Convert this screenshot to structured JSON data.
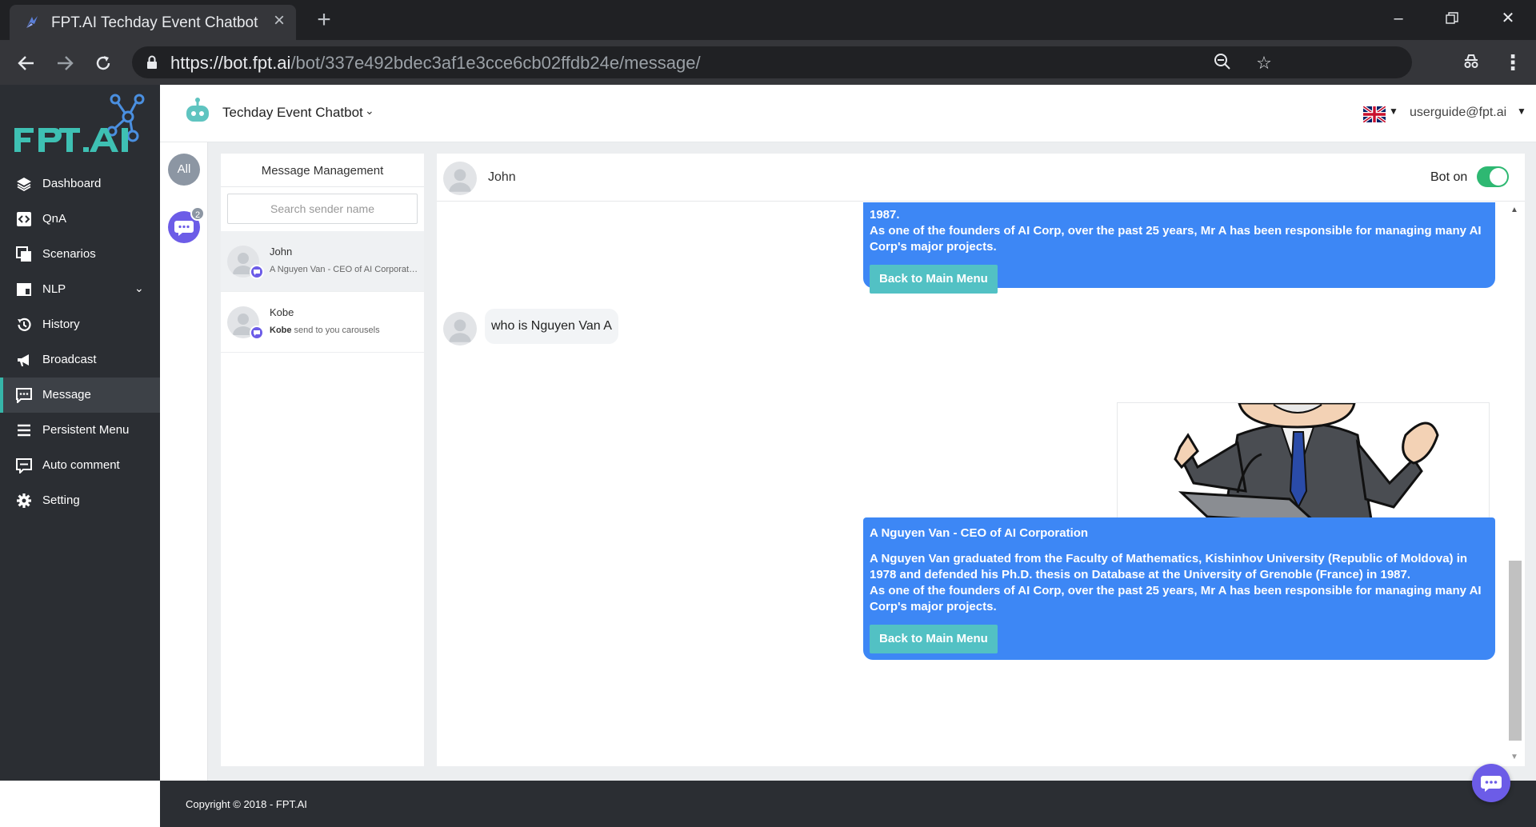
{
  "browser": {
    "tab_title": "FPT.AI Techday Event Chatbot",
    "url_host": "https://bot.fpt.ai",
    "url_path": "/bot/337e492bdec3af1e3cce6cb02ffdb24e/message/"
  },
  "sidebar": {
    "items": [
      {
        "label": "Dashboard",
        "icon": "layers-icon"
      },
      {
        "label": "QnA",
        "icon": "code-icon"
      },
      {
        "label": "Scenarios",
        "icon": "scenarios-icon"
      },
      {
        "label": "NLP",
        "icon": "nlp-icon"
      },
      {
        "label": "History",
        "icon": "history-icon"
      },
      {
        "label": "Broadcast",
        "icon": "megaphone-icon"
      },
      {
        "label": "Message",
        "icon": "message-icon"
      },
      {
        "label": "Persistent Menu",
        "icon": "hamburger-icon"
      },
      {
        "label": "Auto comment",
        "icon": "comment-icon"
      },
      {
        "label": "Setting",
        "icon": "gear-icon"
      }
    ],
    "active_item": "Message"
  },
  "header": {
    "bot_name": "Techday Event Chatbot",
    "user_email": "userguide@fpt.ai"
  },
  "filters": {
    "all_label": "All",
    "message_badge": "2"
  },
  "message_list": {
    "title": "Message Management",
    "search_placeholder": "Search sender name",
    "conversations": [
      {
        "name": "John",
        "preview": "A Nguyen Van - CEO of AI Corporation"
      },
      {
        "name": "Kobe",
        "preview_sender": "Kobe",
        "preview": " send to you carousels"
      }
    ]
  },
  "chat": {
    "contact_name": "John",
    "bot_on_label": "Bot on",
    "messages": [
      {
        "lines": [
          "1987.",
          "As one of the founders of AI Corp, over the past 25 years, Mr A has been responsible for managing many AI Corp's major projects."
        ],
        "button": "Back to Main Menu"
      },
      {
        "user_text": "who is Nguyen Van A"
      },
      {
        "title": "A Nguyen Van - CEO of AI Corporation",
        "body1": "A Nguyen Van graduated from the Faculty of Mathematics, Kishinhov University (Republic of Moldova) in 1978 and defended his Ph.D. thesis on Database at the University of Grenoble (France) in 1987.",
        "body2": "As one of the founders of AI Corp, over the past 25 years, Mr A has been responsible for managing many AI Corp's major projects.",
        "button": "Back to Main Menu"
      }
    ]
  },
  "footer": {
    "copyright": "Copyright © 2018 - FPT.AI"
  },
  "colors": {
    "sidebar_bg": "#2b2e33",
    "accent_teal": "#36b6a9",
    "bot_bubble": "#3d87f5",
    "bubble_button": "#52c1c4",
    "toggle_on": "#2eb872",
    "purple": "#6c5ce7"
  }
}
